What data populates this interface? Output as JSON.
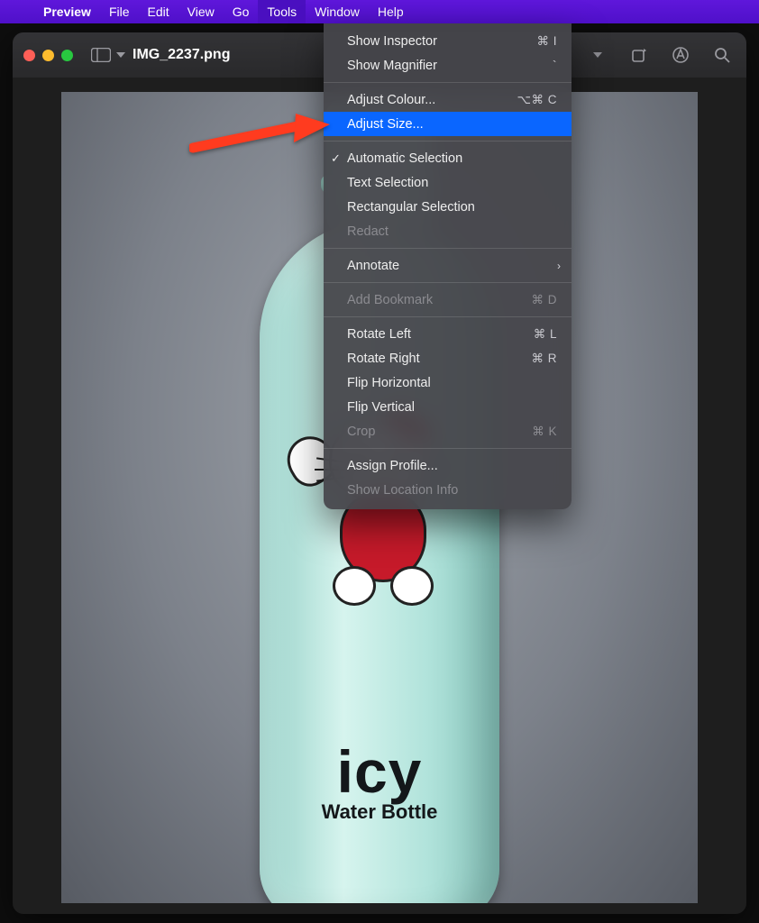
{
  "menubar": {
    "app": "Preview",
    "items": [
      "File",
      "Edit",
      "View",
      "Go",
      "Tools",
      "Window",
      "Help"
    ],
    "active_index": 4
  },
  "window": {
    "title": "IMG_2237.png"
  },
  "bottle": {
    "brand_big": "icy",
    "brand_sub": "Water Bottle"
  },
  "tools_menu": {
    "groups": [
      [
        {
          "label": "Show Inspector",
          "shortcut": "⌘ I",
          "enabled": true
        },
        {
          "label": "Show Magnifier",
          "shortcut": "`",
          "enabled": true
        }
      ],
      [
        {
          "label": "Adjust Colour...",
          "shortcut": "⌥⌘ C",
          "enabled": true
        },
        {
          "label": "Adjust Size...",
          "shortcut": "",
          "enabled": true,
          "highlight": true
        }
      ],
      [
        {
          "label": "Automatic Selection",
          "shortcut": "",
          "enabled": true,
          "checked": true
        },
        {
          "label": "Text Selection",
          "shortcut": "",
          "enabled": true
        },
        {
          "label": "Rectangular Selection",
          "shortcut": "",
          "enabled": true
        },
        {
          "label": "Redact",
          "shortcut": "",
          "enabled": false
        }
      ],
      [
        {
          "label": "Annotate",
          "shortcut": "",
          "enabled": true,
          "submenu": true
        }
      ],
      [
        {
          "label": "Add Bookmark",
          "shortcut": "⌘ D",
          "enabled": false
        }
      ],
      [
        {
          "label": "Rotate Left",
          "shortcut": "⌘ L",
          "enabled": true
        },
        {
          "label": "Rotate Right",
          "shortcut": "⌘ R",
          "enabled": true
        },
        {
          "label": "Flip Horizontal",
          "shortcut": "",
          "enabled": true
        },
        {
          "label": "Flip Vertical",
          "shortcut": "",
          "enabled": true
        },
        {
          "label": "Crop",
          "shortcut": "⌘ K",
          "enabled": false
        }
      ],
      [
        {
          "label": "Assign Profile...",
          "shortcut": "",
          "enabled": true
        },
        {
          "label": "Show Location Info",
          "shortcut": "",
          "enabled": false
        }
      ]
    ]
  }
}
